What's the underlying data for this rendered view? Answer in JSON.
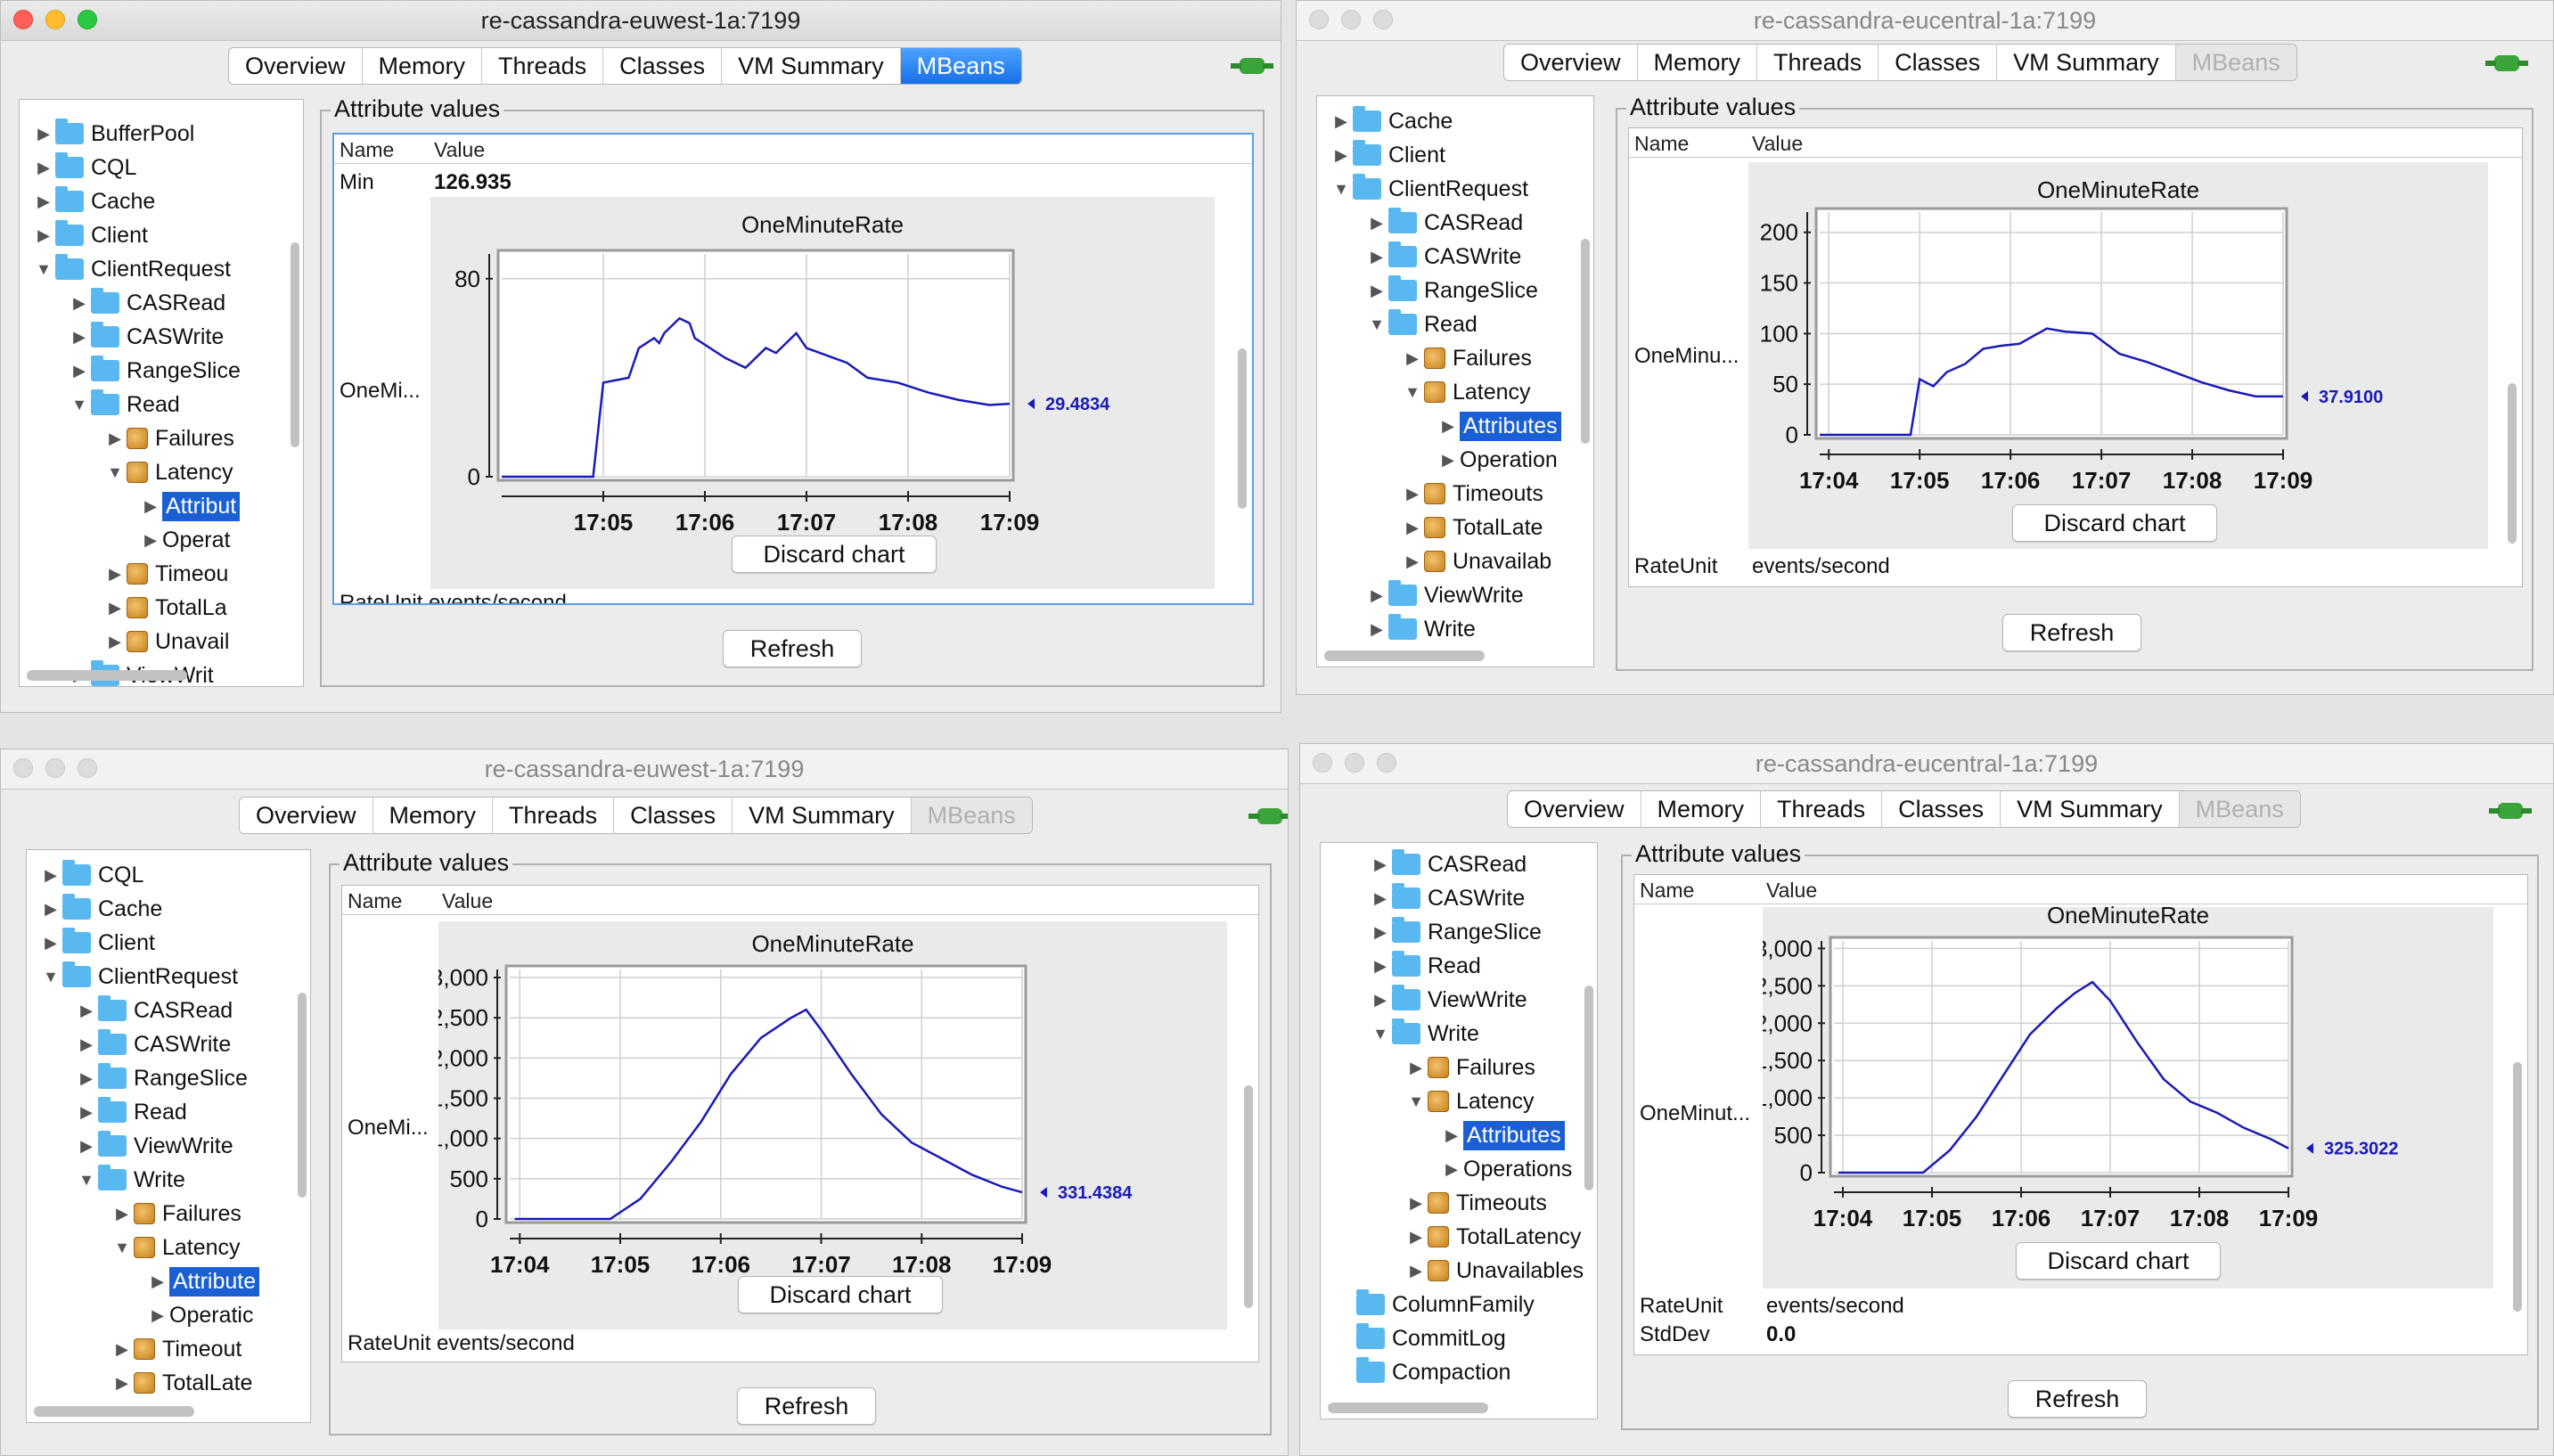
{
  "windows": [
    {
      "title": "re-cassandra-euwest-1a:7199",
      "tabs": [
        "Overview",
        "Memory",
        "Threads",
        "Classes",
        "VM Summary",
        "MBeans"
      ],
      "tree": [
        {
          "label": "BufferPool",
          "arrow": "right",
          "icon": "folder",
          "indent": 0
        },
        {
          "label": "CQL",
          "arrow": "right",
          "icon": "folder",
          "indent": 0
        },
        {
          "label": "Cache",
          "arrow": "right",
          "icon": "folder",
          "indent": 0
        },
        {
          "label": "Client",
          "arrow": "right",
          "icon": "folder",
          "indent": 0
        },
        {
          "label": "ClientRequest",
          "arrow": "down",
          "icon": "folder",
          "indent": 0
        },
        {
          "label": "CASRead",
          "arrow": "right",
          "icon": "folder",
          "indent": 1
        },
        {
          "label": "CASWrite",
          "arrow": "right",
          "icon": "folder",
          "indent": 1
        },
        {
          "label": "RangeSlice",
          "arrow": "right",
          "icon": "folder",
          "indent": 1
        },
        {
          "label": "Read",
          "arrow": "down",
          "icon": "folder",
          "indent": 1
        },
        {
          "label": "Failures",
          "arrow": "right",
          "icon": "bean",
          "indent": 2
        },
        {
          "label": "Latency",
          "arrow": "down",
          "icon": "bean",
          "indent": 2
        },
        {
          "label": "Attribut",
          "arrow": "right",
          "icon": "none",
          "indent": 3,
          "selected": true
        },
        {
          "label": "Operat",
          "arrow": "right",
          "icon": "none",
          "indent": 3
        },
        {
          "label": "Timeou",
          "arrow": "right",
          "icon": "bean",
          "indent": 2
        },
        {
          "label": "TotalLa",
          "arrow": "right",
          "icon": "bean",
          "indent": 2
        },
        {
          "label": "Unavail",
          "arrow": "right",
          "icon": "bean",
          "indent": 2
        },
        {
          "label": "ViewWrit",
          "arrow": "right",
          "icon": "folder",
          "indent": 1
        }
      ],
      "group_title": "Attribute values",
      "col_name": "Name",
      "col_value": "Value",
      "rows_top": [
        {
          "name": "Min",
          "value": "126.935"
        }
      ],
      "row_chart_name": "OneMi...",
      "rows_bottom": [
        {
          "name": "RateUnit",
          "value": "events/second"
        }
      ],
      "chart_title": "OneMinuteRate",
      "discard_label": "Discard chart",
      "refresh_label": "Refresh",
      "chart_data": {
        "type": "line",
        "title": "OneMinuteRate",
        "x_ticks": [
          "17:05",
          "17:06",
          "17:07",
          "17:08",
          "17:09"
        ],
        "y_ticks": [
          "80",
          "0"
        ],
        "ylim": [
          0,
          90
        ],
        "x": [
          "17:04.0",
          "17:04.5",
          "17:04.9",
          "17:05.0",
          "17:05.25",
          "17:05.35",
          "17:05.5",
          "17:05.55",
          "17:05.6",
          "17:05.75",
          "17:05.85",
          "17:05.9",
          "17:06.2",
          "17:06.4",
          "17:06.6",
          "17:06.7",
          "17:06.9",
          "17:07.0",
          "17:07.4",
          "17:07.6",
          "17:07.9",
          "17:08.2",
          "17:08.5",
          "17:08.8",
          "17:09.0"
        ],
        "values": [
          0,
          0,
          0,
          38,
          40,
          52,
          56,
          54,
          58,
          64,
          62,
          56,
          48,
          44,
          52,
          50,
          58,
          52,
          46,
          40,
          38,
          34,
          31,
          29,
          29.4834
        ],
        "current_label": "29.4834",
        "color": "#1a1ab8"
      }
    },
    {
      "title": "re-cassandra-eucentral-1a:7199",
      "tabs": [
        "Overview",
        "Memory",
        "Threads",
        "Classes",
        "VM Summary",
        "MBeans"
      ],
      "tree": [
        {
          "label": "Cache",
          "arrow": "right",
          "icon": "folder",
          "indent": 0
        },
        {
          "label": "Client",
          "arrow": "right",
          "icon": "folder",
          "indent": 0
        },
        {
          "label": "ClientRequest",
          "arrow": "down",
          "icon": "folder",
          "indent": 0
        },
        {
          "label": "CASRead",
          "arrow": "right",
          "icon": "folder",
          "indent": 1
        },
        {
          "label": "CASWrite",
          "arrow": "right",
          "icon": "folder",
          "indent": 1
        },
        {
          "label": "RangeSlice",
          "arrow": "right",
          "icon": "folder",
          "indent": 1
        },
        {
          "label": "Read",
          "arrow": "down",
          "icon": "folder",
          "indent": 1
        },
        {
          "label": "Failures",
          "arrow": "right",
          "icon": "bean",
          "indent": 2
        },
        {
          "label": "Latency",
          "arrow": "down",
          "icon": "bean",
          "indent": 2
        },
        {
          "label": "Attributes",
          "arrow": "right",
          "icon": "none",
          "indent": 3,
          "selected": true
        },
        {
          "label": "Operation",
          "arrow": "right",
          "icon": "none",
          "indent": 3
        },
        {
          "label": "Timeouts",
          "arrow": "right",
          "icon": "bean",
          "indent": 2
        },
        {
          "label": "TotalLate",
          "arrow": "right",
          "icon": "bean",
          "indent": 2
        },
        {
          "label": "Unavailab",
          "arrow": "right",
          "icon": "bean",
          "indent": 2
        },
        {
          "label": "ViewWrite",
          "arrow": "right",
          "icon": "folder",
          "indent": 1
        },
        {
          "label": "Write",
          "arrow": "right",
          "icon": "folder",
          "indent": 1
        }
      ],
      "group_title": "Attribute values",
      "col_name": "Name",
      "col_value": "Value",
      "rows_top": [],
      "row_chart_name": "OneMinu...",
      "rows_bottom": [
        {
          "name": "RateUnit",
          "value": "events/second"
        }
      ],
      "chart_title": "OneMinuteRate",
      "discard_label": "Discard chart",
      "refresh_label": "Refresh",
      "chart_data": {
        "type": "line",
        "title": "OneMinuteRate",
        "x_ticks": [
          "17:04",
          "17:05",
          "17:06",
          "17:07",
          "17:08",
          "17:09"
        ],
        "y_ticks": [
          "200",
          "150",
          "100",
          "50",
          "0"
        ],
        "ylim": [
          0,
          220
        ],
        "x": [
          "17:03.9",
          "17:04.5",
          "17:04.9",
          "17:05.0",
          "17:05.15",
          "17:05.3",
          "17:05.5",
          "17:05.7",
          "17:05.9",
          "17:06.1",
          "17:06.4",
          "17:06.6",
          "17:06.9",
          "17:07.2",
          "17:07.5",
          "17:07.8",
          "17:08.1",
          "17:08.4",
          "17:08.7",
          "17:09.0"
        ],
        "values": [
          0,
          0,
          0,
          55,
          48,
          62,
          70,
          85,
          88,
          90,
          105,
          102,
          100,
          80,
          72,
          62,
          52,
          44,
          38,
          37.91
        ],
        "current_label": "37.9100",
        "color": "#1a1ab8"
      }
    },
    {
      "title": "re-cassandra-euwest-1a:7199",
      "tabs": [
        "Overview",
        "Memory",
        "Threads",
        "Classes",
        "VM Summary",
        "MBeans"
      ],
      "tree": [
        {
          "label": "CQL",
          "arrow": "right",
          "icon": "folder",
          "indent": 0
        },
        {
          "label": "Cache",
          "arrow": "right",
          "icon": "folder",
          "indent": 0
        },
        {
          "label": "Client",
          "arrow": "right",
          "icon": "folder",
          "indent": 0
        },
        {
          "label": "ClientRequest",
          "arrow": "down",
          "icon": "folder",
          "indent": 0
        },
        {
          "label": "CASRead",
          "arrow": "right",
          "icon": "folder",
          "indent": 1
        },
        {
          "label": "CASWrite",
          "arrow": "right",
          "icon": "folder",
          "indent": 1
        },
        {
          "label": "RangeSlice",
          "arrow": "right",
          "icon": "folder",
          "indent": 1
        },
        {
          "label": "Read",
          "arrow": "right",
          "icon": "folder",
          "indent": 1
        },
        {
          "label": "ViewWrite",
          "arrow": "right",
          "icon": "folder",
          "indent": 1
        },
        {
          "label": "Write",
          "arrow": "down",
          "icon": "folder",
          "indent": 1
        },
        {
          "label": "Failures",
          "arrow": "right",
          "icon": "bean",
          "indent": 2
        },
        {
          "label": "Latency",
          "arrow": "down",
          "icon": "bean",
          "indent": 2
        },
        {
          "label": "Attribute",
          "arrow": "right",
          "icon": "none",
          "indent": 3,
          "selected": true
        },
        {
          "label": "Operatic",
          "arrow": "right",
          "icon": "none",
          "indent": 3
        },
        {
          "label": "Timeout",
          "arrow": "right",
          "icon": "bean",
          "indent": 2
        },
        {
          "label": "TotalLate",
          "arrow": "right",
          "icon": "bean",
          "indent": 2
        }
      ],
      "group_title": "Attribute values",
      "col_name": "Name",
      "col_value": "Value",
      "rows_top": [],
      "row_chart_name": "OneMi...",
      "rows_bottom": [
        {
          "name": "RateUnit",
          "value": "events/second"
        }
      ],
      "chart_title": "OneMinuteRate",
      "discard_label": "Discard chart",
      "refresh_label": "Refresh",
      "chart_data": {
        "type": "line",
        "title": "OneMinuteRate",
        "x_ticks": [
          "17:04",
          "17:05",
          "17:06",
          "17:07",
          "17:08",
          "17:09"
        ],
        "y_ticks": [
          "3,000",
          "2,500",
          "2,000",
          "1,500",
          "1,000",
          "500",
          "0"
        ],
        "ylim": [
          0,
          3100
        ],
        "x": [
          "17:03.95",
          "17:04.5",
          "17:04.9",
          "17:05.2",
          "17:05.5",
          "17:05.8",
          "17:06.1",
          "17:06.4",
          "17:06.7",
          "17:06.85",
          "17:07.0",
          "17:07.3",
          "17:07.6",
          "17:07.9",
          "17:08.2",
          "17:08.5",
          "17:08.8",
          "17:09.0"
        ],
        "values": [
          0,
          0,
          0,
          250,
          700,
          1200,
          1800,
          2250,
          2500,
          2600,
          2350,
          1800,
          1300,
          950,
          750,
          550,
          400,
          331.4384
        ],
        "current_label": "331.4384",
        "color": "#1a1ab8"
      }
    },
    {
      "title": "re-cassandra-eucentral-1a:7199",
      "tabs": [
        "Overview",
        "Memory",
        "Threads",
        "Classes",
        "VM Summary",
        "MBeans"
      ],
      "tree": [
        {
          "label": "CASRead",
          "arrow": "right",
          "icon": "folder",
          "indent": 1
        },
        {
          "label": "CASWrite",
          "arrow": "right",
          "icon": "folder",
          "indent": 1
        },
        {
          "label": "RangeSlice",
          "arrow": "right",
          "icon": "folder",
          "indent": 1
        },
        {
          "label": "Read",
          "arrow": "right",
          "icon": "folder",
          "indent": 1
        },
        {
          "label": "ViewWrite",
          "arrow": "right",
          "icon": "folder",
          "indent": 1
        },
        {
          "label": "Write",
          "arrow": "down",
          "icon": "folder",
          "indent": 1
        },
        {
          "label": "Failures",
          "arrow": "right",
          "icon": "bean",
          "indent": 2
        },
        {
          "label": "Latency",
          "arrow": "down",
          "icon": "bean",
          "indent": 2
        },
        {
          "label": "Attributes",
          "arrow": "right",
          "icon": "none",
          "indent": 3,
          "selected": true
        },
        {
          "label": "Operations",
          "arrow": "right",
          "icon": "none",
          "indent": 3
        },
        {
          "label": "Timeouts",
          "arrow": "right",
          "icon": "bean",
          "indent": 2
        },
        {
          "label": "TotalLatency",
          "arrow": "right",
          "icon": "bean",
          "indent": 2
        },
        {
          "label": "Unavailables",
          "arrow": "right",
          "icon": "bean",
          "indent": 2
        },
        {
          "label": "ColumnFamily",
          "arrow": "none",
          "icon": "folder",
          "indent": 0
        },
        {
          "label": "CommitLog",
          "arrow": "none",
          "icon": "folder",
          "indent": 0
        },
        {
          "label": "Compaction",
          "arrow": "none",
          "icon": "folder",
          "indent": 0
        }
      ],
      "group_title": "Attribute values",
      "col_name": "Name",
      "col_value": "Value",
      "rows_top": [],
      "row_chart_name": "OneMinut...",
      "rows_bottom": [
        {
          "name": "RateUnit",
          "value": "events/second"
        },
        {
          "name": "StdDev",
          "value": "0.0"
        }
      ],
      "chart_title": "OneMinuteRate",
      "discard_label": "Discard chart",
      "refresh_label": "Refresh",
      "chart_data": {
        "type": "line",
        "title": "OneMinuteRate",
        "x_ticks": [
          "17:04",
          "17:05",
          "17:06",
          "17:07",
          "17:08",
          "17:09"
        ],
        "y_ticks": [
          "3,000",
          "2,500",
          "2,000",
          "1,500",
          "1,000",
          "500",
          "0"
        ],
        "ylim": [
          0,
          3100
        ],
        "x": [
          "17:03.95",
          "17:04.5",
          "17:04.9",
          "17:05.2",
          "17:05.5",
          "17:05.8",
          "17:06.1",
          "17:06.4",
          "17:06.6",
          "17:06.8",
          "17:07.0",
          "17:07.3",
          "17:07.6",
          "17:07.9",
          "17:08.2",
          "17:08.5",
          "17:08.8",
          "17:09.0"
        ],
        "values": [
          0,
          0,
          0,
          300,
          750,
          1300,
          1850,
          2200,
          2400,
          2550,
          2300,
          1750,
          1250,
          950,
          800,
          600,
          450,
          325.3022
        ],
        "current_label": "325.3022",
        "color": "#1a1ab8"
      }
    }
  ]
}
